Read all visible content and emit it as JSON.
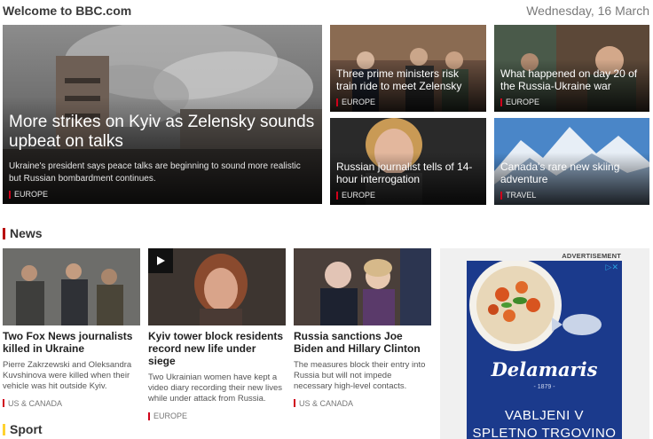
{
  "header": {
    "site_title": "Welcome to BBC.com",
    "date": "Wednesday, 16 March"
  },
  "featured": {
    "main": {
      "headline": "More strikes on Kyiv as Zelensky sounds upbeat on talks",
      "summary": "Ukraine's president says peace talks are beginning to sound more realistic but Russian bombardment continues.",
      "tag": "EUROPE"
    },
    "cards": [
      {
        "headline": "Three prime ministers risk train ride to meet Zelensky",
        "tag": "EUROPE"
      },
      {
        "headline": "What happened on day 20 of the Russia-Ukraine war",
        "tag": "EUROPE"
      },
      {
        "headline": "Russian journalist tells of 14-hour interrogation",
        "tag": "EUROPE"
      },
      {
        "headline": "Canada's rare new skiing adventure",
        "tag": "TRAVEL"
      }
    ]
  },
  "news": {
    "title": "News",
    "items": [
      {
        "headline": "Two Fox News journalists killed in Ukraine",
        "summary": "Pierre Zakrzewski and Oleksandra Kuvshinova were killed when their vehicle was hit outside Kyiv.",
        "tag": "US & CANADA"
      },
      {
        "headline": "Kyiv tower block residents record new life under siege",
        "summary": "Two Ukrainian women have kept a video diary recording their new lives while under attack from Russia.",
        "tag": "EUROPE"
      },
      {
        "headline": "Russia sanctions Joe Biden and Hillary Clinton",
        "summary": "The measures block their entry into Russia but will not impede necessary high-level contacts.",
        "tag": "US & CANADA"
      }
    ]
  },
  "sport": {
    "title": "Sport"
  },
  "ad": {
    "label": "ADVERTISEMENT",
    "brand": "Delamaris",
    "year": "- 1879 -",
    "line1": "VABLJENI V",
    "line2": "SPLETNO TRGOVINO"
  }
}
